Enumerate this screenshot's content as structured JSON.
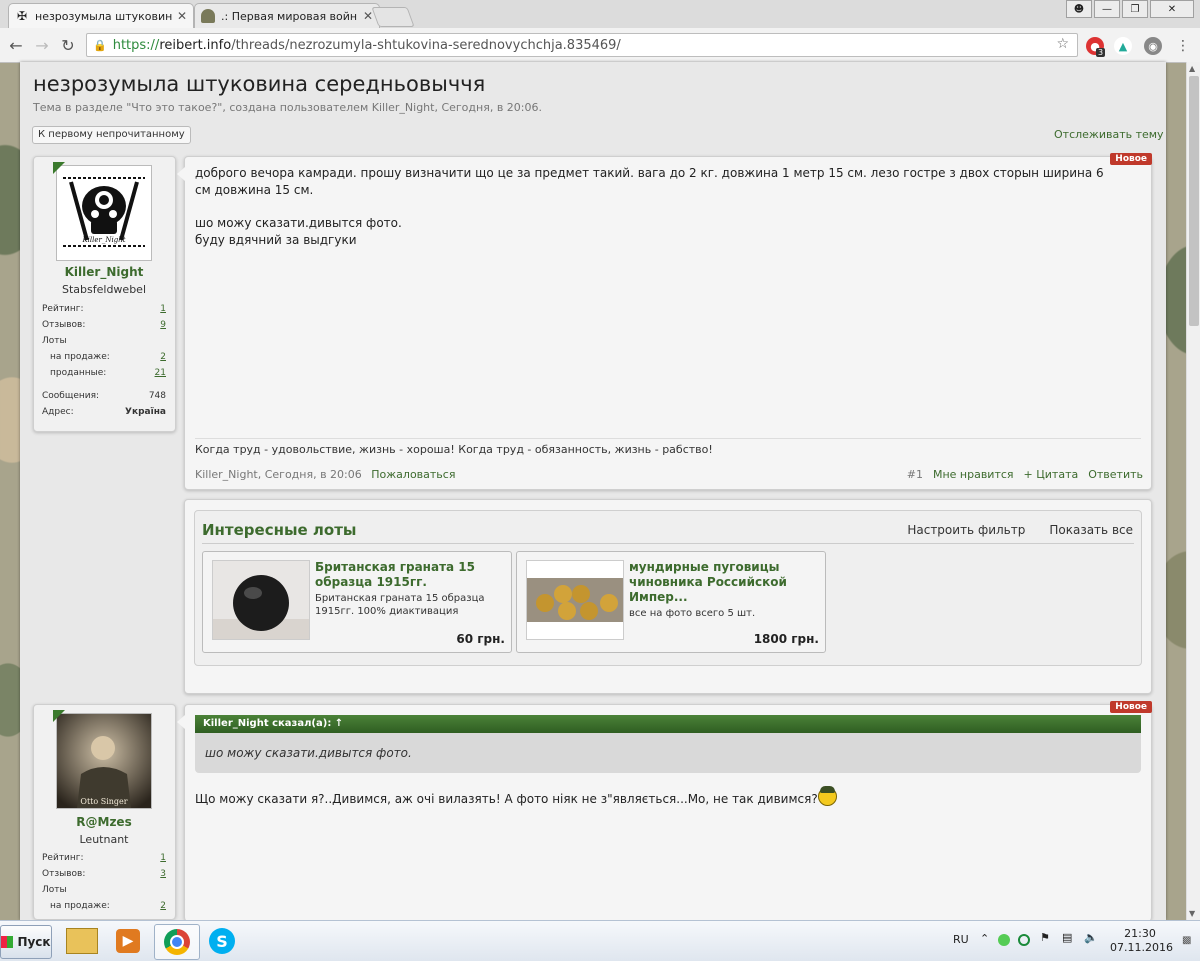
{
  "browser": {
    "tabs": [
      {
        "label": "незрозумыла штуковин",
        "active": true
      },
      {
        "label": ".: Первая мировая войн",
        "active": false
      }
    ],
    "url_scheme": "https://",
    "url_host": "reibert.info",
    "url_path": "/threads/nezrozumyla-shtukovina-serednovychchja.835469/",
    "ext_badge": "3"
  },
  "thread": {
    "title": "незрозумыла штуковина середньовыччя",
    "description": "Тема в разделе \"Что это такое?\", создана пользователем Killer_Night, Сегодня, в 20:06.",
    "first_unread": "К первому непрочитанному",
    "watch": "Отслеживать тему"
  },
  "post1": {
    "user": {
      "name": "Killer_Night",
      "rank": "Stabsfeldwebel",
      "avatar_text": "Killer_Night",
      "stats": [
        {
          "label": "Рейтинг:",
          "value": "1",
          "style": "link"
        },
        {
          "label": "Отзывов:",
          "value": "9",
          "style": "link"
        },
        {
          "label": "Лоты",
          "value": "",
          "style": "plain"
        },
        {
          "label": "на продаже:",
          "value": "2",
          "style": "link"
        },
        {
          "label": "проданные:",
          "value": "21",
          "style": "link"
        },
        {
          "label": "Сообщения:",
          "value": "748",
          "style": "plain"
        },
        {
          "label": "Адрес:",
          "value": "Україна",
          "style": "bold"
        }
      ]
    },
    "badge": "Новое",
    "lines": [
      "доброго вечора камради. прошу визначити що це за предмет такий. вага до 2 кг. довжина 1 метр 15 см. лезо гостре з двох сторын ширина 6",
      "см довжина 15 см.",
      "",
      "шо можу сказати.дивытся фото.",
      "буду вдячний за выдгуки"
    ],
    "signature": "Когда труд - удовольствие, жизнь - хороша! Когда труд - обязанность, жизнь - рабство!",
    "meta": "Killer_Night, Сегодня, в 20:06",
    "report": "Пожаловаться",
    "actions": {
      "num": "#1",
      "like": "Мне нравится",
      "quote": "+ Цитата",
      "reply": "Ответить"
    }
  },
  "lots": {
    "title": "Интересные лоты",
    "filter": "Настроить фильтр",
    "show_all": "Показать все",
    "items": [
      {
        "title": "Британская граната 15 образца 1915гг.",
        "desc": "Британская граната 15 образца 1915гг. 100% диактивация",
        "price": "60 грн."
      },
      {
        "title": "мундирные пуговицы чиновника Российской Импер...",
        "desc": "все на фото всего 5 шт.",
        "price": "1800 грн."
      }
    ]
  },
  "post2": {
    "user": {
      "name": "R@Mzes",
      "rank": "Leutnant",
      "avatar_text": "Otto Singer",
      "stats": [
        {
          "label": "Рейтинг:",
          "value": "1",
          "style": "link"
        },
        {
          "label": "Отзывов:",
          "value": "3",
          "style": "link"
        },
        {
          "label": "Лоты",
          "value": "",
          "style": "plain"
        },
        {
          "label": "на продаже:",
          "value": "2",
          "style": "link"
        }
      ]
    },
    "badge": "Новое",
    "quote_head": "Killer_Night сказал(а): ↑",
    "quote_text": "шо можу сказати.дивытся фото.",
    "text": "Що можу сказати я?..Дивимся, аж очі вилазять! А фото ніяк не з\"являється...Мо, не так дивимся?"
  },
  "taskbar": {
    "start": "Пуск",
    "lang": "RU",
    "time": "21:30",
    "date": "07.11.2016"
  }
}
